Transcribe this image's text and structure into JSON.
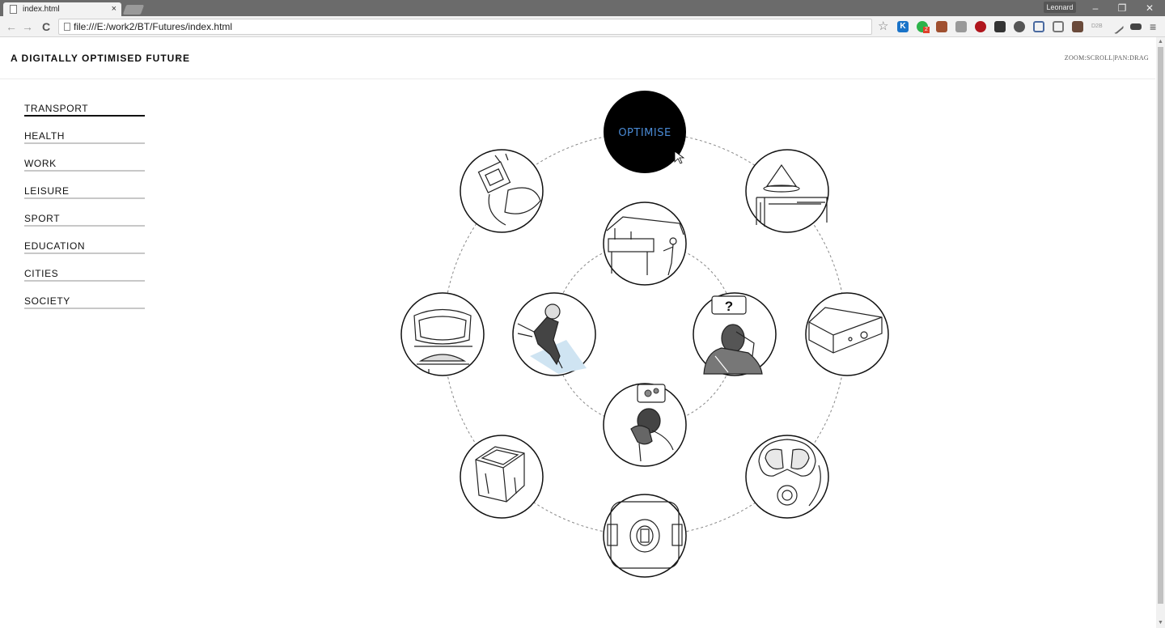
{
  "browser": {
    "tab_title": "index.html",
    "tab_close": "×",
    "profile_name": "Leonard",
    "url": "file:///E:/work2/BT/Futures/index.html",
    "window_controls": {
      "minimize": "–",
      "restore": "❐",
      "close": "✕"
    },
    "nav": {
      "back": "←",
      "forward": "→",
      "reload": "C"
    },
    "extensions": [
      "star-icon",
      "k-extension-icon",
      "evernote-icon",
      "bag-icon",
      "camera-icon",
      "ublock-icon",
      "buffer-icon",
      "headphones-icon",
      "screenshot-icon",
      "cast-icon",
      "portrait-icon",
      "d2b-icon",
      "eyedropper-icon",
      "ticket-icon",
      "menu-icon"
    ],
    "extension_text": {
      "d2b": "D2B",
      "evernote_badge": "2"
    }
  },
  "header": {
    "title": "A DIGITALLY OPTIMISED FUTURE",
    "slashes": "//",
    "hint": "ZOOM:SCROLL|PAN:DRAG"
  },
  "menu": {
    "items": [
      {
        "label": "TRANSPORT",
        "active": true
      },
      {
        "label": "HEALTH",
        "active": false
      },
      {
        "label": "WORK",
        "active": false
      },
      {
        "label": "LEISURE",
        "active": false
      },
      {
        "label": "SPORT",
        "active": false
      },
      {
        "label": "EDUCATION",
        "active": false
      },
      {
        "label": "CITIES",
        "active": false
      },
      {
        "label": "SOCIETY",
        "active": false
      }
    ]
  },
  "diagram": {
    "center_label": "OPTIMISE",
    "center_label_color": "#4a8ad4",
    "question_mark": "?",
    "outer_nodes": [
      "satellite-device-illustration",
      "lamp-appliance-illustration",
      "router-box-illustration",
      "diving-mask-illustration",
      "robot-vacuum-illustration",
      "cube-gadget-illustration",
      "smart-scale-illustration"
    ],
    "inner_nodes": [
      "kitchen-person-illustration",
      "confused-man-illustration",
      "thinking-child-illustration",
      "skydiver-illustration"
    ]
  }
}
